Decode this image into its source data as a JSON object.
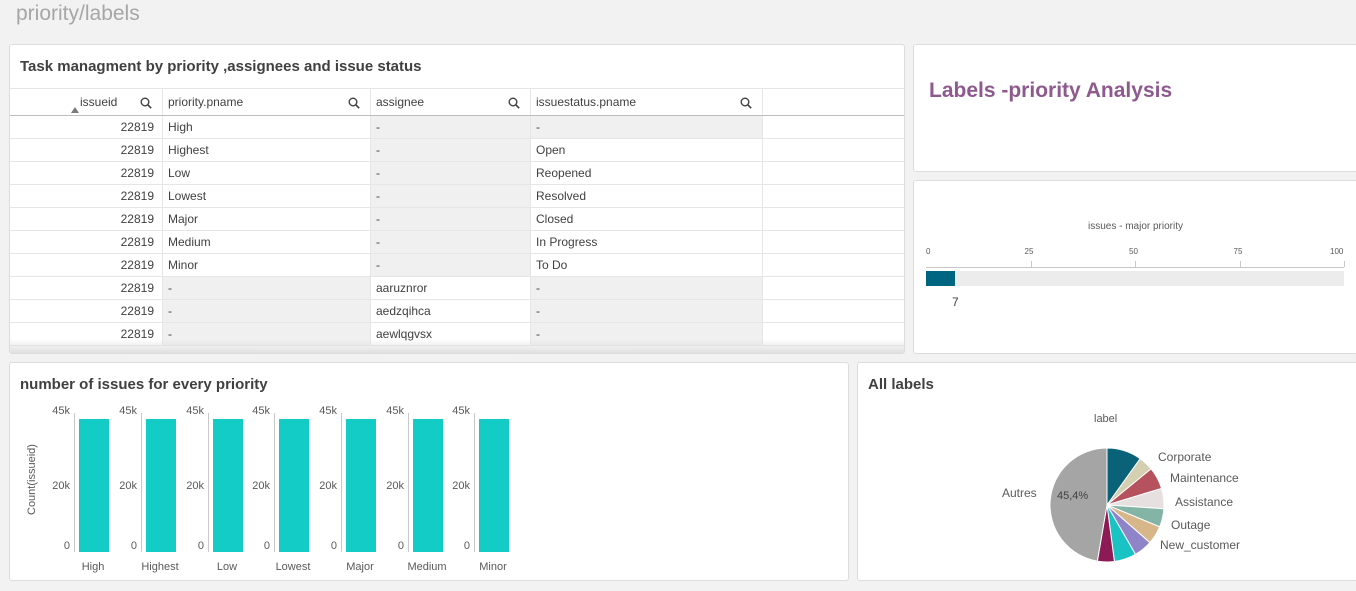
{
  "sheet_title": "priority/labels",
  "table_panel": {
    "title": "Task managment by priority ,assignees and issue status",
    "headers": [
      "issueid",
      "priority.pname",
      "assignee",
      "issuestatus.pname"
    ],
    "rows": [
      [
        "22819",
        "High",
        "-",
        "-"
      ],
      [
        "22819",
        "Highest",
        "-",
        "Open"
      ],
      [
        "22819",
        "Low",
        "-",
        "Reopened"
      ],
      [
        "22819",
        "Lowest",
        "-",
        "Resolved"
      ],
      [
        "22819",
        "Major",
        "-",
        "Closed"
      ],
      [
        "22819",
        "Medium",
        "-",
        "In Progress"
      ],
      [
        "22819",
        "Minor",
        "-",
        "To Do"
      ],
      [
        "22819",
        "-",
        "aaruznror",
        "-"
      ],
      [
        "22819",
        "-",
        "aedzqihca",
        "-"
      ],
      [
        "22819",
        "-",
        "aewlqgvsx",
        "-"
      ]
    ]
  },
  "header_panel": {
    "title": "Labels -priority Analysis"
  },
  "gauge": {
    "title": "issues - major priority",
    "ticks": [
      "0",
      "25",
      "50",
      "75",
      "100"
    ],
    "value": 7,
    "value_label": "7",
    "max": 100,
    "color": "#006580"
  },
  "bars_panel": {
    "title": "number of issues for every priority",
    "ylabel": "Count(issueid)",
    "color": "#13ccc5",
    "chart_data": {
      "type": "bar",
      "categories": [
        "High",
        "Highest",
        "Low",
        "Lowest",
        "Major",
        "Medium",
        "Minor"
      ],
      "values": [
        43000,
        43000,
        43000,
        43000,
        43000,
        43000,
        43000
      ],
      "ytick_labels": [
        "45k",
        "20k",
        "0"
      ],
      "ylim": [
        0,
        45000
      ],
      "ylabel": "Count(issueid)"
    }
  },
  "pie_panel": {
    "title": "All labels",
    "chart_data": {
      "type": "pie",
      "title": "label",
      "slices": [
        {
          "label": "Corporate",
          "value": 9.5,
          "color": "#0a6279"
        },
        {
          "label": "",
          "value": 4.0,
          "color": "#d4cfb0"
        },
        {
          "label": "Maintenance",
          "value": 6.0,
          "color": "#b5525d"
        },
        {
          "label": "Assistance",
          "value": 5.5,
          "color": "#e6e0e0"
        },
        {
          "label": "",
          "value": 5.0,
          "color": "#83b4a5"
        },
        {
          "label": "Outage",
          "value": 5.0,
          "color": "#d7b789"
        },
        {
          "label": "",
          "value": 5.0,
          "color": "#8f84c7"
        },
        {
          "label": "New_customer",
          "value": 6.0,
          "color": "#19c3c3"
        },
        {
          "label": "",
          "value": 4.6,
          "color": "#8b1a55"
        },
        {
          "label": "Autres",
          "value": 45.4,
          "color": "#a5a5a5"
        }
      ],
      "data_label": "45,4%"
    }
  }
}
